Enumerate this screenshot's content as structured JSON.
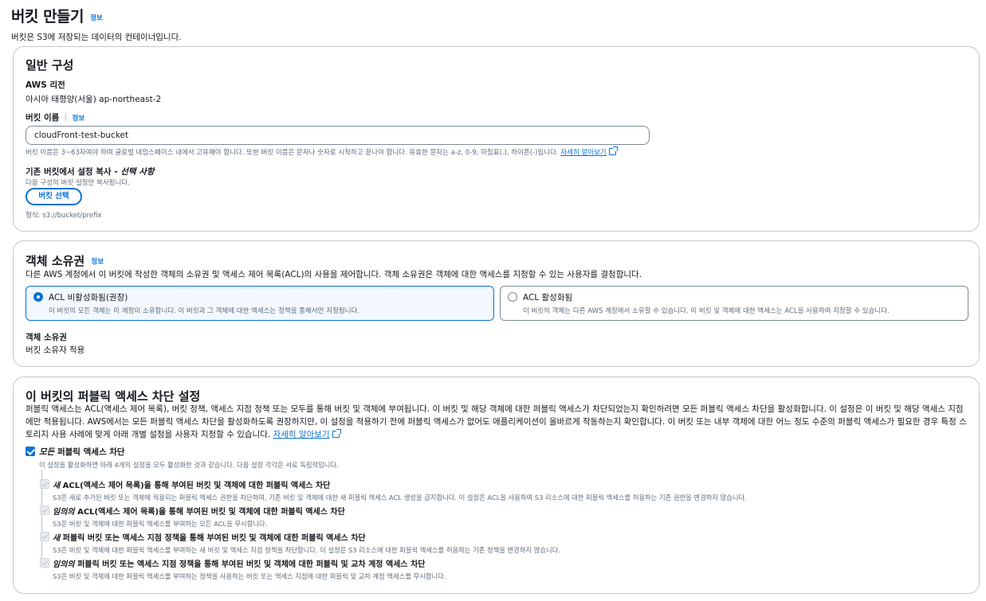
{
  "page": {
    "title": "버킷 만들기",
    "info": "정보",
    "description": "버킷은 S3에 저장되는 데이터의 컨테이너입니다."
  },
  "general": {
    "title": "일반 구성",
    "region_label": "AWS 리전",
    "region_value": "아시아 태평양(서울) ap-northeast-2",
    "bucket_name_label": "버킷 이름",
    "bucket_name_info": "정보",
    "bucket_name_value": "cloudFront-test-bucket",
    "bucket_name_hint": "버킷 이름은 3~63자여야 하며 글로벌 네임스페이스 내에서 고유해야 합니다. 또한 버킷 이름은 문자나 숫자로 시작하고 끝나야 합니다. 유효한 문자는 a-z, 0-9, 마침표(.), 하이픈(-)입니다.",
    "learn_more": "자세히 알아보기",
    "copy_label_main": "기존 버킷에서 설정 복사 - ",
    "copy_label_optional": "선택 사항",
    "copy_hint": "다음 구성의 버킷 설정만 복사됩니다.",
    "choose_bucket_button": "버킷 선택",
    "format_hint": "형식: s3://bucket/prefix"
  },
  "ownership": {
    "title": "객체 소유권",
    "info": "정보",
    "description": "다른 AWS 계정에서 이 버킷에 작성한 객체의 소유권 및 액세스 제어 목록(ACL)의 사용을 제어합니다. 객체 소유권은 객체에 대한 액세스를 지정할 수 있는 사용자를 결정합니다.",
    "options": [
      {
        "label": "ACL 비활성화됨(권장)",
        "description": "이 버킷의 모든 객체는 이 계정이 소유합니다. 이 버킷과 그 객체에 대한 액세스는 정책을 통해서만 지정됩니다.",
        "selected": true
      },
      {
        "label": "ACL 활성화됨",
        "description": "이 버킷의 객체는 다른 AWS 계정에서 소유할 수 있습니다. 이 버킷 및 객체에 대한 액세스는 ACL을 사용하여 지정할 수 있습니다.",
        "selected": false
      }
    ],
    "object_ownership_label": "객체 소유권",
    "object_ownership_value": "버킷 소유자 적용"
  },
  "public_access": {
    "title": "이 버킷의 퍼블릭 액세스 차단 설정",
    "description": "퍼블릭 액세스는 ACL(액세스 제어 목록), 버킷 정책, 액세스 지점 정책 또는 모두를 통해 버킷 및 객체에 부여됩니다. 이 버킷 및 해당 객체에 대한 퍼블릭 액세스가 차단되었는지 확인하려면 모든 퍼블릭 액세스 차단을 활성화합니다. 이 설정은 이 버킷 및 해당 액세스 지점에만 적용됩니다. AWS에서는 모든 퍼블릭 액세스 차단을 활성화하도록 권장하지만, 이 설정을 적용하기 전에 퍼블릭 액세스가 없어도 애플리케이션이 올바르게 작동하는지 확인합니다. 이 버킷 또는 내부 객체에 대한 어느 정도 수준의 퍼블릭 액세스가 필요한 경우 특정 스토리지 사용 사례에 맞게 아래 개별 설정을 사용자 지정할 수 있습니다.",
    "learn_more": "자세히 알아보기",
    "block_all": {
      "label_em": "모든",
      "label_rest": " 퍼블릭 액세스 차단",
      "description": "이 설정을 활성화하면 아래 4개의 설정을 모두 활성화한 것과 같습니다. 다음 설정 각각은 서로 독립적입니다.",
      "checked": true
    },
    "sub_options": [
      {
        "label_em": "새",
        "label_rest": " ACL(액세스 제어 목록)을 통해 부여된 버킷 및 객체에 대한 퍼블릭 액세스 차단",
        "description": "S3은 새로 추가된 버킷 또는 객체에 적용되는 퍼블릭 액세스 권한을 차단하며, 기존 버킷 및 객체에 대한 새 퍼블릭 액세스 ACL 생성을 금지합니다. 이 설정은 ACL을 사용하여 S3 리소스에 대한 퍼블릭 액세스를 허용하는 기존 권한을 변경하지 않습니다."
      },
      {
        "label_em": "임의의",
        "label_rest": " ACL(액세스 제어 목록)을 통해 부여된 버킷 및 객체에 대한 퍼블릭 액세스 차단",
        "description": "S3은 버킷 및 객체에 대한 퍼블릭 액세스를 부여하는 모든 ACL을 무시합니다."
      },
      {
        "label_em": "새",
        "label_rest": " 퍼블릭 버킷 또는 액세스 지점 정책을 통해 부여된 버킷 및 객체에 대한 퍼블릭 액세스 차단",
        "description": "S3은 버킷 및 객체에 대한 퍼블릭 액세스를 부여하는 새 버킷 및 액세스 지점 정책을 차단합니다. 이 설정은 S3 리소스에 대한 퍼블릭 액세스를 허용하는 기존 정책을 변경하지 않습니다."
      },
      {
        "label_em": "임의의",
        "label_rest": " 퍼블릭 버킷 또는 액세스 지점 정책을 통해 부여된 버킷 및 객체에 대한 퍼블릭 및 교차 계정 액세스 차단",
        "description": "S3은 버킷 및 객체에 대한 퍼블릭 액세스를 부여하는 정책을 사용하는 버킷 또는 액세스 지점에 대한 퍼블릭 및 교차 계정 액세스를 무시합니다."
      }
    ]
  }
}
